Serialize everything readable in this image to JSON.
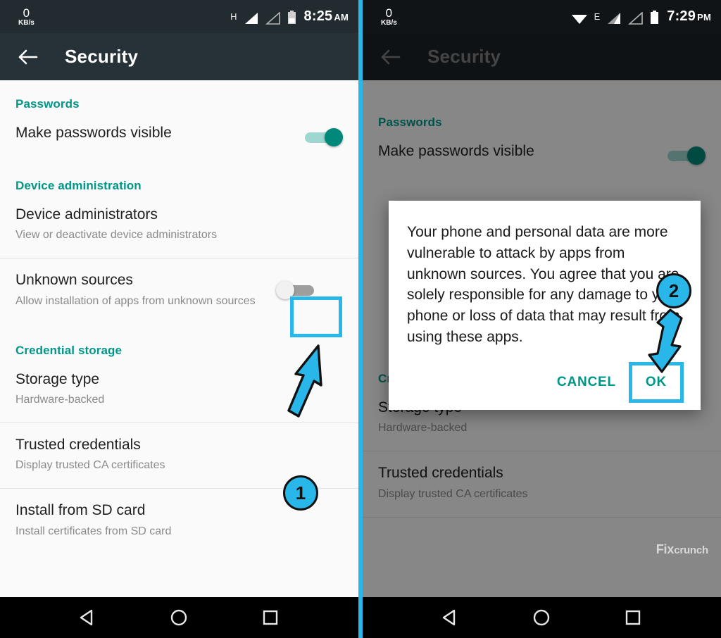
{
  "left": {
    "status": {
      "net_speed_value": "0",
      "net_speed_unit": "KB/s",
      "network_type": "H",
      "time": "8:25",
      "meridiem": "AM"
    },
    "appbar": {
      "title": "Security",
      "back_icon": "back-arrow-icon"
    },
    "sections": {
      "passwords": {
        "header": "Passwords",
        "row_title": "Make passwords visible",
        "toggle_state": "on"
      },
      "device_administration": {
        "header": "Device administration",
        "row_title": "Device administrators",
        "row_sub": "View or deactivate device administrators"
      },
      "unknown_sources": {
        "row_title": "Unknown sources",
        "row_sub": "Allow installation of apps from unknown sources",
        "toggle_state": "off"
      },
      "credential_storage": {
        "header": "Credential storage",
        "storage_type_title": "Storage type",
        "storage_type_sub": "Hardware-backed",
        "trusted_title": "Trusted credentials",
        "trusted_sub": "Display trusted CA certificates",
        "install_title": "Install from SD card",
        "install_sub": "Install certificates from SD card"
      }
    },
    "annotation": {
      "step": "1"
    }
  },
  "right": {
    "status": {
      "net_speed_value": "0",
      "net_speed_unit": "KB/s",
      "network_type": "E",
      "time": "7:29",
      "meridiem": "PM"
    },
    "appbar": {
      "title": "Security",
      "back_icon": "back-arrow-icon"
    },
    "sections": {
      "passwords": {
        "header": "Passwords",
        "row_title": "Make passwords visible",
        "toggle_state": "on"
      },
      "credential_storage": {
        "header": "Credential storage",
        "storage_type_title": "Storage type",
        "storage_type_sub": "Hardware-backed",
        "trusted_title": "Trusted credentials",
        "trusted_sub": "Display trusted CA certificates"
      }
    },
    "dialog": {
      "message": "Your phone and personal data are more vulnerable to attack by apps from unknown sources. You agree that you are solely responsible for any damage to your phone or loss of data that may result from using these apps.",
      "cancel_label": "CANCEL",
      "ok_label": "OK"
    },
    "annotation": {
      "step": "2"
    },
    "watermark": {
      "prefix": "Fix",
      "suffix": "crunch"
    }
  },
  "navbar": {
    "back": "back-triangle-icon",
    "home": "home-circle-icon",
    "recents": "recents-square-icon"
  },
  "colors": {
    "accent_teal": "#009688",
    "highlight_cyan": "#29b6e8",
    "appbar_dark": "#263238",
    "statusbar_dark": "#222b30"
  }
}
